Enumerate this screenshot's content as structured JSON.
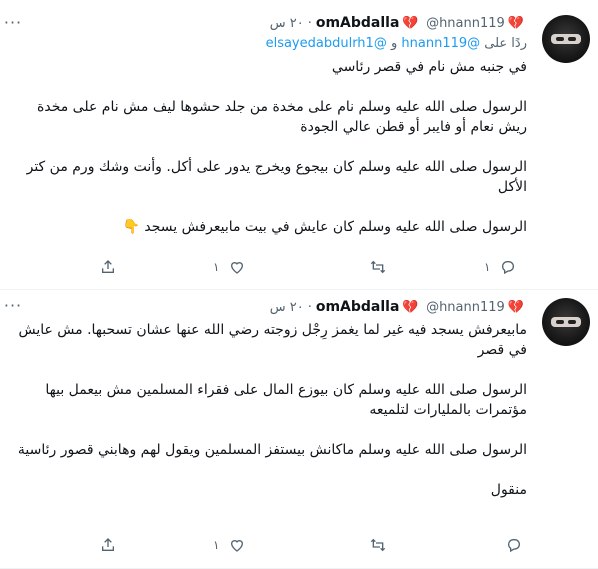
{
  "tweets": [
    {
      "display_name": "omAbdalla",
      "handle": "@hnann119",
      "time": "٢٠ س",
      "reply_prefix": "ردًا على",
      "reply_mention_1": "@hnann119",
      "reply_and": "و",
      "reply_mention_2": "@elsayedabdulrh1",
      "paragraphs": [
        "في جنبه مش نام في قصر رئاسي",
        "الرسول صلى الله عليه وسلم نام على مخدة من جلد حشوها ليف مش نام على مخدة ريش نعام أو فايبر أو قطن عالي الجودة",
        "الرسول صلى الله عليه وسلم كان بيجوع ويخرج يدور على أكل. وأنت وشك ورم من كتر الأكل",
        "الرسول صلى الله عليه وسلم كان عايش في بيت مابيعرفش يسجد 👇"
      ],
      "reply_count": "١",
      "like_count": "١"
    },
    {
      "display_name": "omAbdalla",
      "handle": "@hnann119",
      "time": "٢٠ س",
      "paragraphs": [
        "مابيعرفش يسجد فيه غير لما يغمز رِجْل زوجته رضي الله عنها عشان تسحبها. مش عايش في قصر",
        "الرسول صلى الله عليه وسلم كان بيوزع المال على فقراء المسلمين مش بيعمل بيها مؤتمرات بالمليارات لتلميعه",
        "الرسول صلى الله عليه وسلم ماكانش بيستفز المسلمين ويقول لهم وهابني قصور رئاسية",
        "منقول"
      ],
      "reply_count": "",
      "like_count": "١"
    }
  ],
  "icons": {
    "heart": "broken-heart-icon",
    "more": "more-icon",
    "reply": "reply-icon",
    "retweet": "retweet-icon",
    "like": "like-icon",
    "share": "share-icon"
  }
}
